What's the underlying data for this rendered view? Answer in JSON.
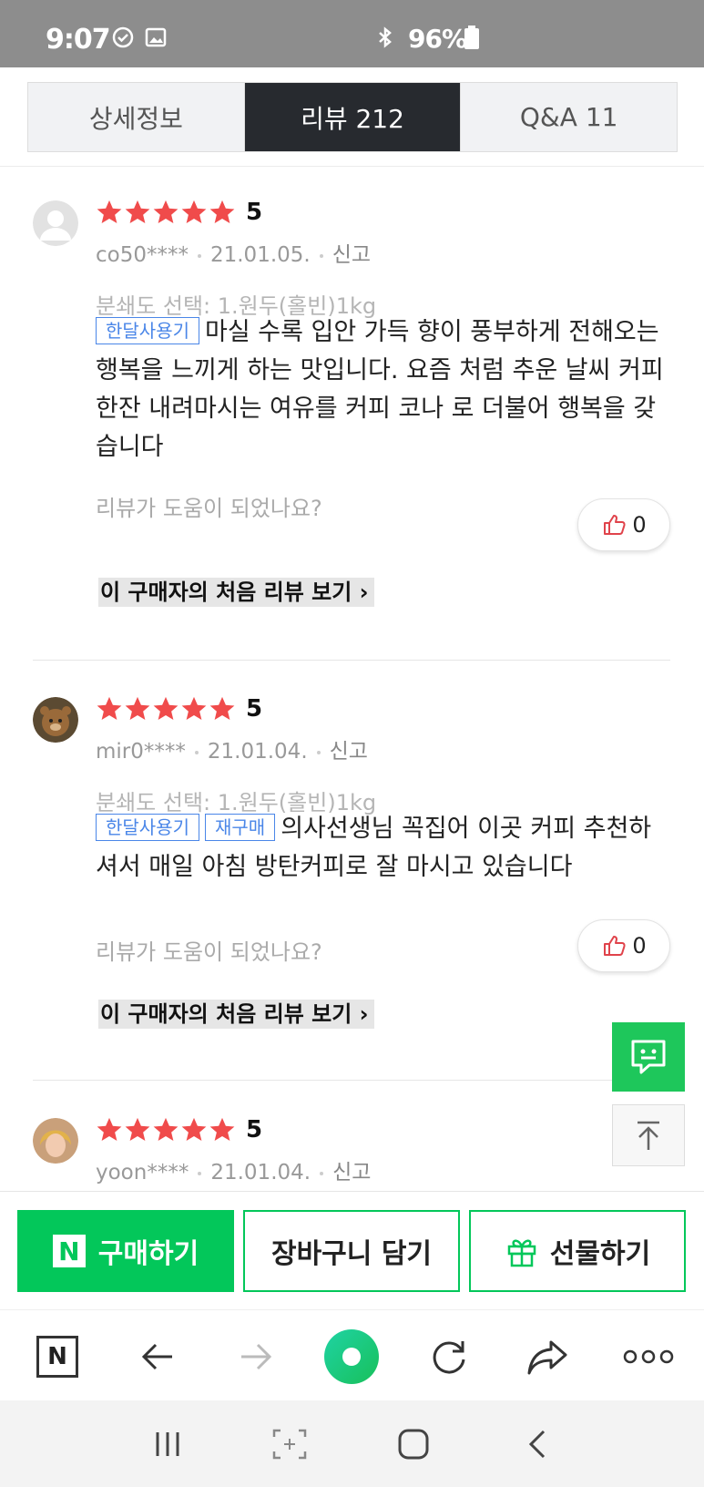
{
  "status_bar": {
    "time": "9:07",
    "battery": "96%"
  },
  "tabs": [
    {
      "label": "상세정보"
    },
    {
      "label": "리뷰  212"
    },
    {
      "label": "Q&A  11"
    }
  ],
  "reviews": [
    {
      "score": "5",
      "user": "co50****",
      "date": "21.01.05.",
      "report": "신고",
      "option": "분쇄도 선택: 1.원두(홀빈)1kg",
      "tags": [
        "한달사용기"
      ],
      "text": "마실 수록  입안 가득 향이 풍부하게 전해오는 행복을 느끼게 하는 맛입니다. 요즘 처럼  추운 날씨  커피 한잔 내려마시는 여유를 커피 코나 로 더불어  행복을 갖습니다",
      "helpful_question": "리뷰가 도움이 되었나요?",
      "likes": "0",
      "first_review_link": "이 구매자의 처음 리뷰 보기"
    },
    {
      "score": "5",
      "user": "mir0****",
      "date": "21.01.04.",
      "report": "신고",
      "option": "분쇄도 선택: 1.원두(홀빈)1kg",
      "tags": [
        "한달사용기",
        "재구매"
      ],
      "text": "의사선생님 꼭집어 이곳 커피 추천하셔서  매일 아침 방탄커피로 잘 마시고 있습니다",
      "helpful_question": "리뷰가 도움이 되었나요?",
      "likes": "0",
      "first_review_link": "이 구매자의 처음 리뷰 보기"
    },
    {
      "score": "5",
      "user": "yoon****",
      "date": "21.01.04.",
      "report": "신고"
    }
  ],
  "buy_bar": {
    "buy_label": "구매하기",
    "cart_label": "장바구니 담기",
    "gift_label": "선물하기",
    "naver_badge": "N"
  },
  "browser_bar": {
    "naver_badge": "N"
  },
  "colors": {
    "accent_green": "#03c75a",
    "star_red": "#f04b4b",
    "tag_blue": "#4a86e8",
    "tab_active": "#272a2f"
  }
}
